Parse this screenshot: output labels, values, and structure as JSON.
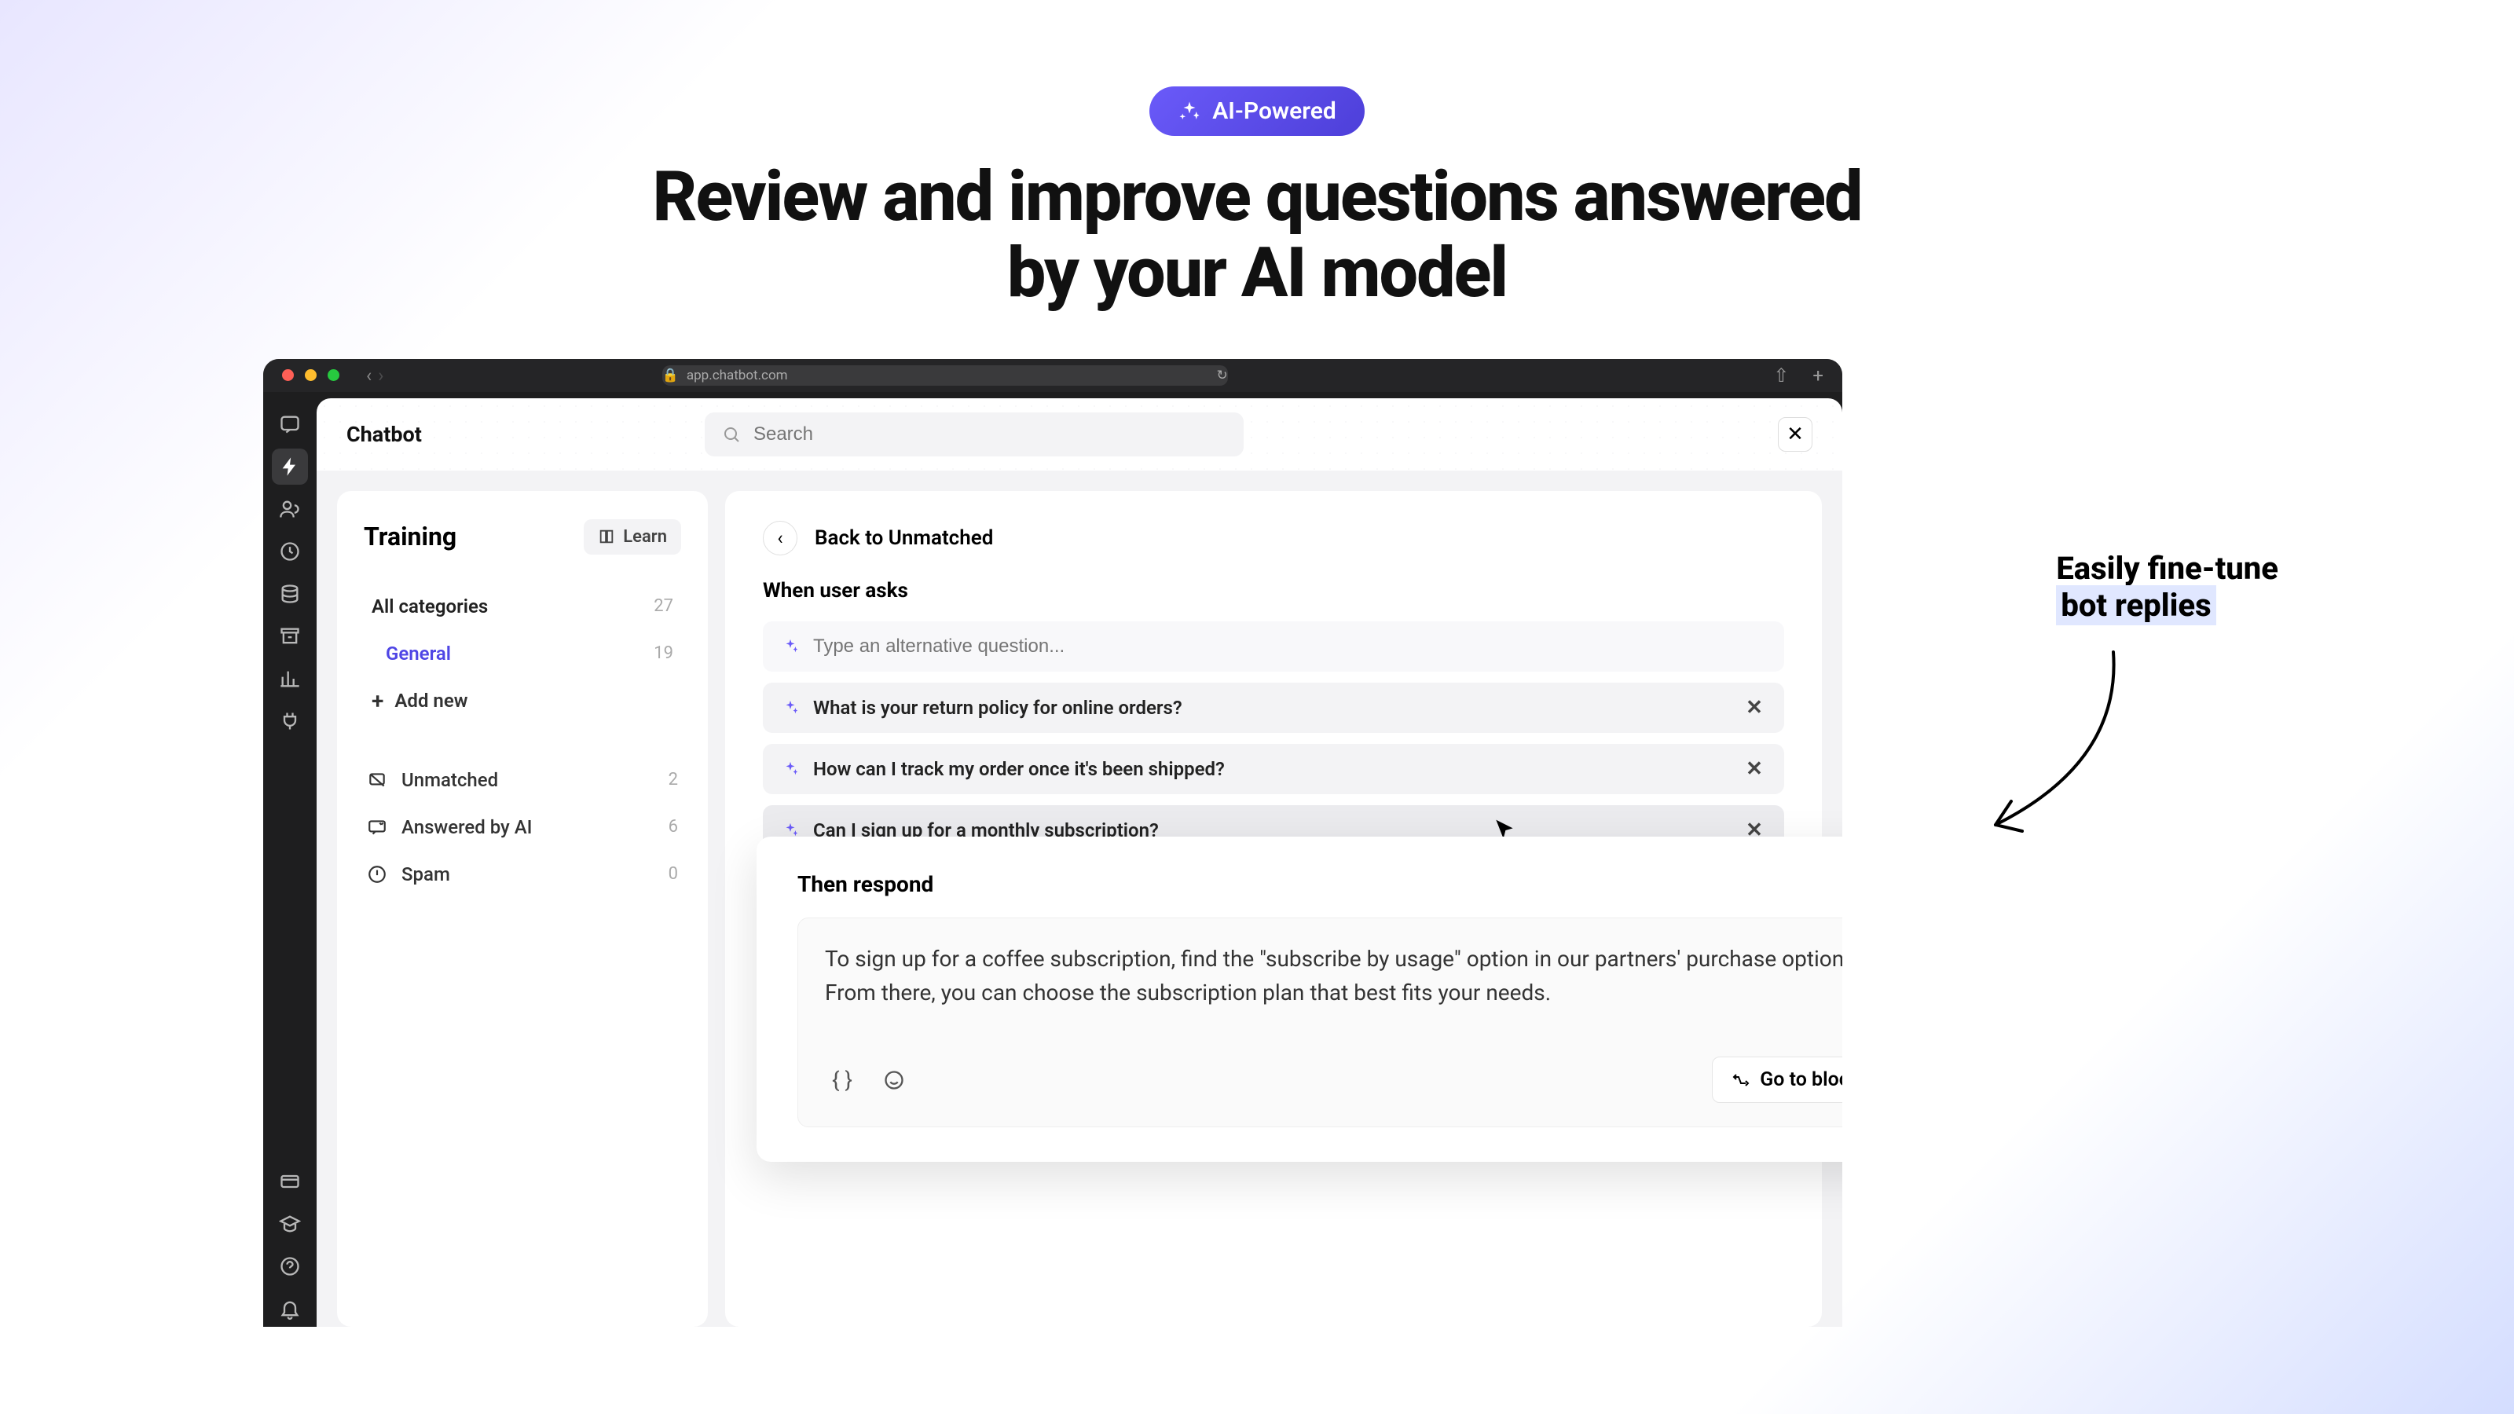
{
  "hero": {
    "badge": "AI-Powered",
    "title_line1": "Review and improve questions answered",
    "title_line2": "by your AI model"
  },
  "browser": {
    "url": "app.chatbot.com"
  },
  "topbar": {
    "app_title": "Chatbot",
    "search_placeholder": "Search"
  },
  "sidebar": {
    "title": "Training",
    "learn_label": "Learn",
    "categories": [
      {
        "label": "All categories",
        "count": "27",
        "selected": false,
        "nested": false
      },
      {
        "label": "General",
        "count": "19",
        "selected": true,
        "nested": true
      }
    ],
    "add_new": "Add new",
    "statuses": [
      {
        "icon": "unmatched",
        "label": "Unmatched",
        "count": "2"
      },
      {
        "icon": "ai",
        "label": "Answered by AI",
        "count": "6"
      },
      {
        "icon": "spam",
        "label": "Spam",
        "count": "0"
      }
    ]
  },
  "main": {
    "back_label": "Back to Unmatched",
    "when_label": "When user asks",
    "alt_placeholder": "Type an alternative question...",
    "questions": [
      "What is your return policy for online orders?",
      "How can I track my order once it's been shipped?",
      "Can I sign up for a monthly subscription?"
    ]
  },
  "respond": {
    "label": "Then respond",
    "text": "To sign up for a coffee subscription, find the \"subscribe by usage\" option in our partners' purchase options. From there, you can choose the subscription plan that best fits your needs.",
    "goto_label": "Go to block"
  },
  "callout": {
    "line1": "Easily fine-tune",
    "line2": "bot replies"
  }
}
